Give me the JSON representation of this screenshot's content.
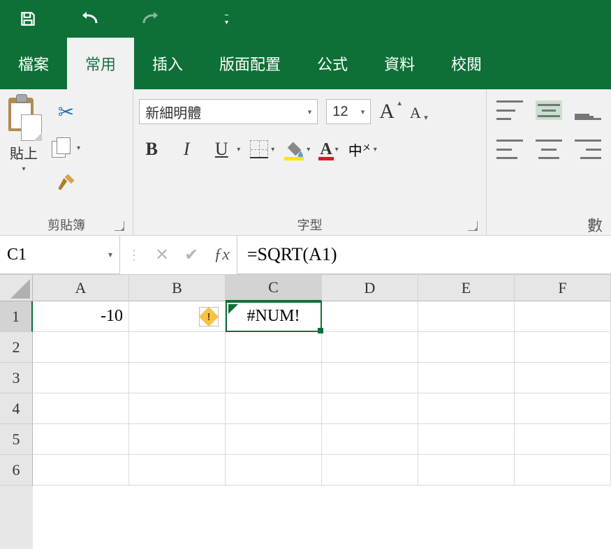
{
  "qat": {
    "save": "save",
    "undo": "undo",
    "redo": "redo"
  },
  "tabs": {
    "file": "檔案",
    "home": "常用",
    "insert": "插入",
    "layout": "版面配置",
    "formulas": "公式",
    "data": "資料",
    "review": "校閱"
  },
  "ribbon": {
    "clipboard": {
      "paste": "貼上",
      "label": "剪貼簿"
    },
    "font": {
      "name": "新細明體",
      "size": "12",
      "label": "字型"
    },
    "alignment_partial_label": "數"
  },
  "fbar": {
    "namebox": "C1",
    "formula": "=SQRT(A1)"
  },
  "columns": [
    "A",
    "B",
    "C",
    "D",
    "E",
    "F"
  ],
  "rows": [
    "1",
    "2",
    "3",
    "4",
    "5",
    "6"
  ],
  "cells": {
    "A1": "-10",
    "C1": "#NUM!"
  },
  "selected_cell": "C1"
}
